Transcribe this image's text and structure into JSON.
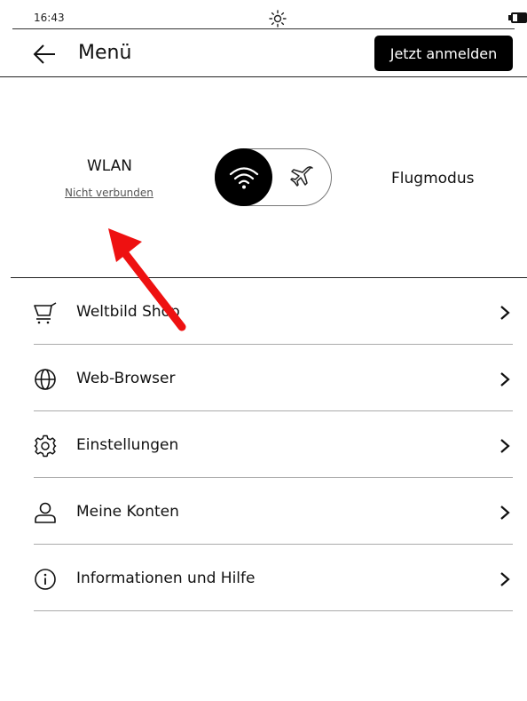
{
  "status": {
    "time": "16:43",
    "brightness_icon": "sun-icon",
    "battery_icon": "battery-icon"
  },
  "header": {
    "back_icon": "arrow-left-icon",
    "title": "Menü",
    "login_label": "Jetzt anmelden"
  },
  "connection": {
    "wlan_label": "WLAN",
    "wlan_status": "Nicht verbunden",
    "toggle_state": "wlan",
    "flight_label": "Flugmodus"
  },
  "menu": {
    "items": [
      {
        "label": "Weltbild Shop",
        "icon": "cart-icon"
      },
      {
        "label": "Web-Browser",
        "icon": "globe-icon"
      },
      {
        "label": "Einstellungen",
        "icon": "gear-icon"
      },
      {
        "label": "Meine Konten",
        "icon": "user-icon"
      },
      {
        "label": "Informationen und Hilfe",
        "icon": "info-icon"
      }
    ]
  },
  "colors": {
    "accent": "#000000",
    "annotation_arrow": "#ee1111",
    "divider": "#aaaaaa"
  }
}
